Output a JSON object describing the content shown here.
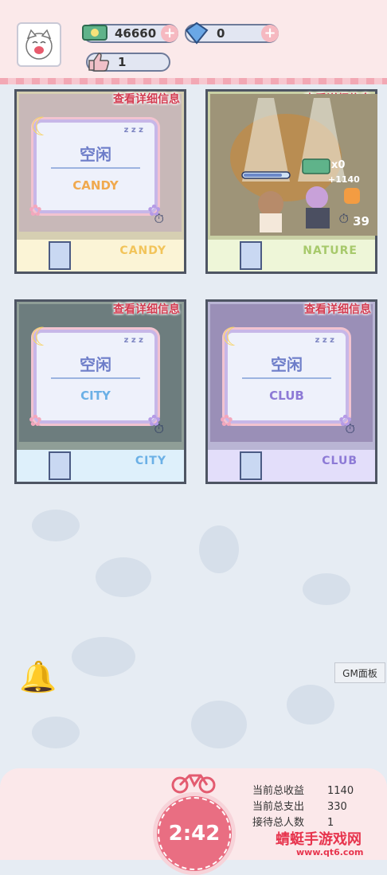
{
  "resources": {
    "cash": "46660",
    "gems": "0",
    "likes": "1"
  },
  "rooms": [
    {
      "detail_label": "查看详细信息",
      "status": "空闲",
      "brand": "CANDY",
      "sign": "CANDY",
      "accent": "#f2a3b5"
    },
    {
      "detail_label": "查看详细信息",
      "cash_count": "x0",
      "income": "+1140",
      "timer": "39",
      "sign": "NATURE",
      "accent": "#9bc46a"
    },
    {
      "detail_label": "查看详细信息",
      "status": "空闲",
      "brand": "CITY",
      "sign": "CITY",
      "accent": "#6bb0e6"
    },
    {
      "detail_label": "查看详细信息",
      "status": "空闲",
      "brand": "CLUB",
      "sign": "CLUB",
      "accent": "#8d7ad6"
    }
  ],
  "gm_panel": "GM面板",
  "timer": "2:42",
  "stats": [
    {
      "label": "当前总收益",
      "value": "1140"
    },
    {
      "label": "当前总支出",
      "value": "330"
    },
    {
      "label": "接待总人数",
      "value": "1"
    }
  ],
  "watermark": "蜻蜓手游戏网",
  "watermark_url": "www.qt6.com"
}
